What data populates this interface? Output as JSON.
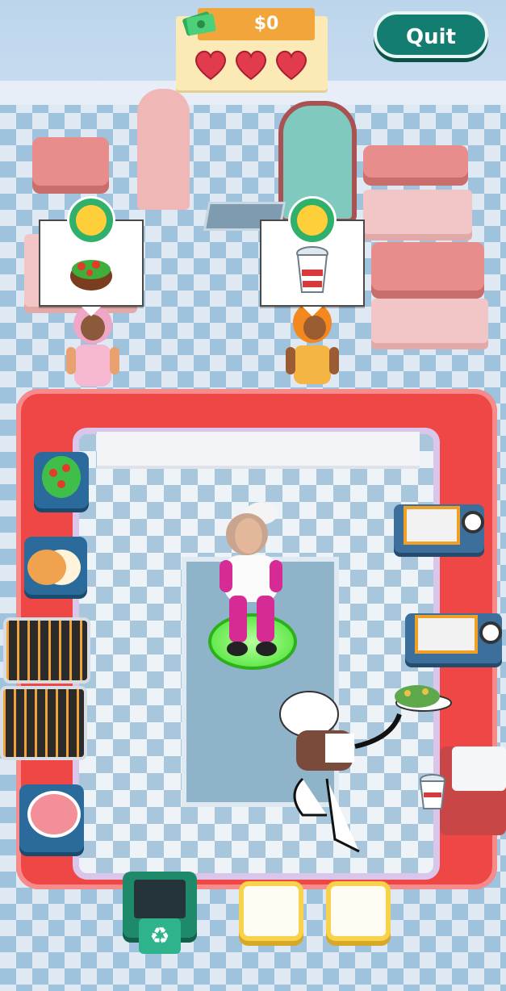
{
  "hud": {
    "money": "$0",
    "lives": 3,
    "quit_label": "Quit"
  },
  "orders": [
    {
      "customer": "left",
      "item": "salad-bowl-icon",
      "mood": "happy"
    },
    {
      "customer": "right",
      "item": "drink-cup-icon",
      "mood": "happy"
    }
  ],
  "stations": [
    "salad-ingredients",
    "burger-buns",
    "grill-top",
    "grill-bottom",
    "patty-plate",
    "fryer-top",
    "fryer-bottom",
    "drink-machine",
    "trash-bin",
    "plate-slot-1",
    "plate-slot-2"
  ],
  "colors": {
    "counter": "#ef4646",
    "hud_money": "#f2a53a",
    "quit_button": "#127d70",
    "player_ring": "#44e02c"
  }
}
